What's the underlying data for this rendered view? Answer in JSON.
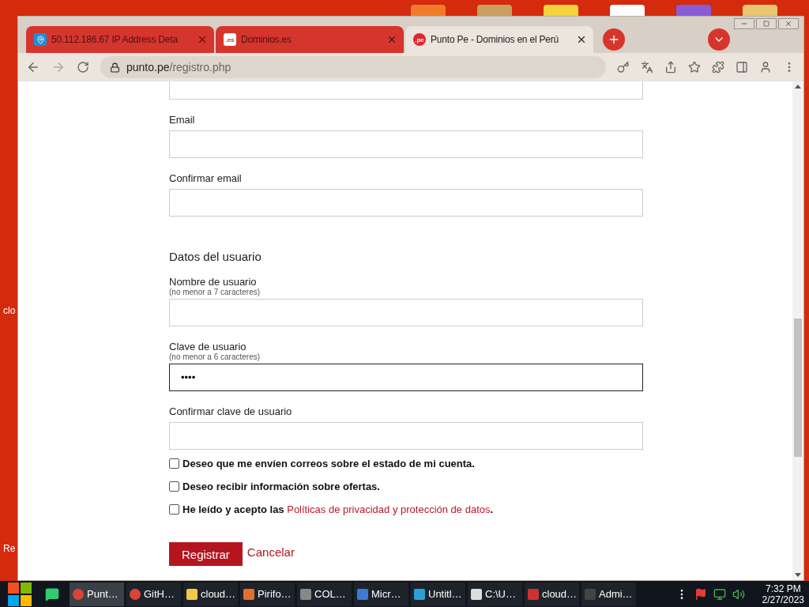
{
  "desktop": {
    "labels": [
      "clo",
      "Re"
    ]
  },
  "browser": {
    "tabs": [
      {
        "title": "50.112.186.67 IP Address Deta",
        "selected": false
      },
      {
        "title": "Dominios.es",
        "selected": false
      },
      {
        "title": "Punto Pe - Dominios en el Perú",
        "selected": true
      }
    ],
    "favicon_text": [
      ".es",
      ".pe"
    ],
    "url": {
      "host": "punto.pe",
      "path": "/registro.php"
    }
  },
  "page": {
    "contact_fields": [
      {
        "label": "Email",
        "focused": false
      },
      {
        "label": "Confirmar email",
        "focused": false
      }
    ],
    "section_title": "Datos del usuario",
    "user_fields": [
      {
        "label": "Nombre de usuario",
        "hint": "(no menor a 7 caracteres)",
        "focused": false
      },
      {
        "label": "Clave de usuario",
        "hint": "(no menor a 6 caracteres)",
        "value": "••••",
        "focused": true
      },
      {
        "label": "Confirmar clave de usuario",
        "focused": false
      }
    ],
    "checkboxes": [
      {
        "label": "Deseo que me envíen correos sobre el estado de mi cuenta.",
        "checked": false
      },
      {
        "label": "Deseo recibir información sobre ofertas.",
        "checked": false
      },
      {
        "label": "He leído y acepto las ",
        "link": "Políticas de privacidad y protección de datos",
        "after": ".",
        "checked": false
      }
    ],
    "buttons": [
      {
        "label": "Registrar",
        "kind": "primary"
      },
      {
        "label": "Cancelar",
        "kind": "link"
      }
    ]
  },
  "taskbar": {
    "items": [
      {
        "label": "Punt…",
        "selected": true
      },
      {
        "label": "GitH…",
        "selected": false
      },
      {
        "label": "cloud…",
        "selected": false
      },
      {
        "label": "Pirifo…",
        "selected": false
      },
      {
        "label": "COL…",
        "selected": false
      },
      {
        "label": "Micr…",
        "selected": false
      },
      {
        "label": "Untitl…",
        "selected": false
      },
      {
        "label": "C:\\U…",
        "selected": false
      },
      {
        "label": "cloud…",
        "selected": false
      },
      {
        "label": "Admi…",
        "selected": false
      }
    ],
    "time": "7:32 PM",
    "date": "2/27/2023"
  }
}
